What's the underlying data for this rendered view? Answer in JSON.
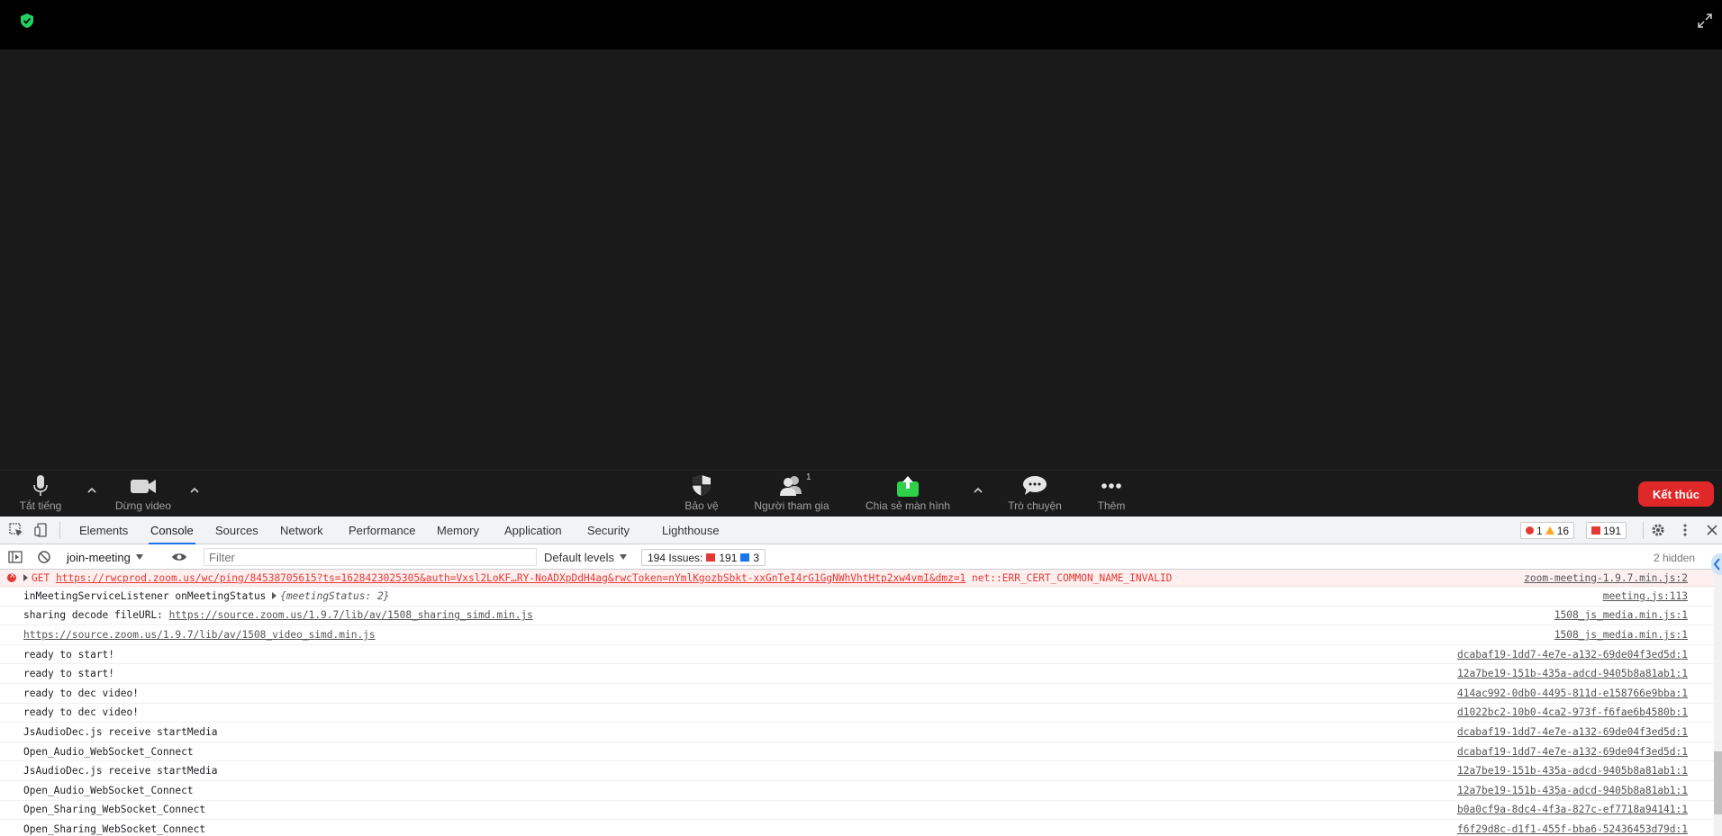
{
  "meeting": {
    "toolbar": {
      "mute_label": "Tắt tiếng",
      "video_label": "Dừng video",
      "security_label": "Bảo vệ",
      "participants_label": "Người tham gia",
      "participants_count": "1",
      "share_label": "Chia sẻ màn hình",
      "chat_label": "Trò chuyện",
      "more_label": "Thêm",
      "end_label": "Kết thúc"
    },
    "colors": {
      "share_green": "#2fd14a",
      "end_red": "#e02828",
      "shield_green": "#23d160"
    }
  },
  "devtools": {
    "tabs": [
      "Elements",
      "Console",
      "Sources",
      "Network",
      "Performance",
      "Memory",
      "Application",
      "Security",
      "Lighthouse"
    ],
    "active_tab": "Console",
    "counts": {
      "errors": "1",
      "warnings": "16",
      "issues_top": "191"
    },
    "toolbar": {
      "context": "join-meeting",
      "filter_placeholder": "Filter",
      "levels": "Default levels",
      "issues_label": "194 Issues:",
      "issues_red": "191",
      "issues_blue": "3",
      "hidden": "2 hidden"
    },
    "console": {
      "error_row": {
        "method": "GET",
        "url": "https://rwcprod.zoom.us/wc/ping/84538705615?ts=1628423025305&auth=Vxsl2LoKF…RY-NoADXpDdH4ag&rwcToken=nYmlKgozbSbkt-xxGnTeI4rG1GgNWhVhtHtp2xw4vmI&dmz=1",
        "message": "net::ERR_CERT_COMMON_NAME_INVALID",
        "source": "zoom-meeting-1.9.7.min.js:2"
      },
      "status_row": {
        "text": "inMeetingServiceListener onMeetingStatus",
        "object": "{meetingStatus: 2}",
        "source": "meeting.js:113"
      },
      "sharing_row": {
        "text": "sharing decode fileURL:",
        "url": "https://source.zoom.us/1.9.7/lib/av/1508_sharing_simd.min.js",
        "source": "1508_js_media.min.js:1"
      },
      "video_url_row": {
        "url": "https://source.zoom.us/1.9.7/lib/av/1508_video_simd.min.js",
        "source": "1508_js_media.min.js:1"
      },
      "rows": [
        {
          "text": "ready to start!",
          "source": "dcabaf19-1dd7-4e7e-a132-69de04f3ed5d:1"
        },
        {
          "text": "ready to start!",
          "source": "12a7be19-151b-435a-adcd-9405b8a81ab1:1"
        },
        {
          "text": "ready to dec video!",
          "source": "414ac992-0db0-4495-811d-e158766e9bba:1"
        },
        {
          "text": "ready to dec video!",
          "source": "d1022bc2-10b0-4ca2-973f-f6fae6b4580b:1"
        },
        {
          "text": "JsAudioDec.js receive startMedia",
          "source": "dcabaf19-1dd7-4e7e-a132-69de04f3ed5d:1"
        },
        {
          "text": "Open_Audio_WebSocket_Connect",
          "source": "dcabaf19-1dd7-4e7e-a132-69de04f3ed5d:1"
        },
        {
          "text": "JsAudioDec.js receive startMedia",
          "source": "12a7be19-151b-435a-adcd-9405b8a81ab1:1"
        },
        {
          "text": "Open_Audio_WebSocket_Connect",
          "source": "12a7be19-151b-435a-adcd-9405b8a81ab1:1"
        },
        {
          "text": "Open_Sharing_WebSocket_Connect",
          "source": "b0a0cf9a-8dc4-4f3a-827c-ef7718a94141:1"
        },
        {
          "text": "Open_Sharing_WebSocket_Connect",
          "source": "f6f29d8c-d1f1-455f-bba6-52436453d79d:1"
        }
      ]
    }
  }
}
